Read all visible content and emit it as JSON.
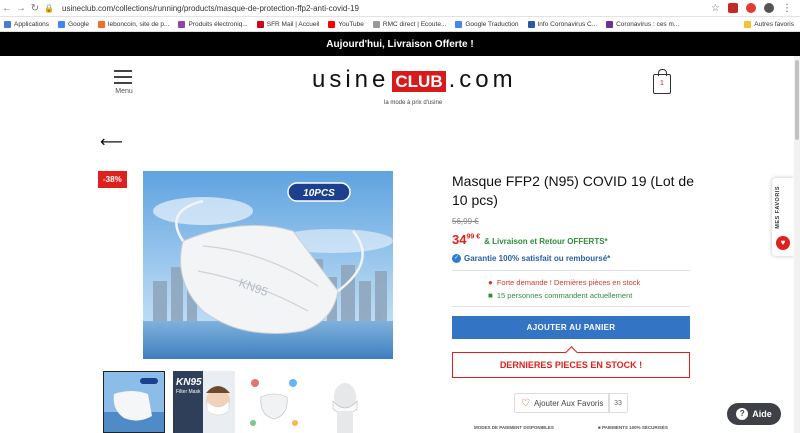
{
  "browser": {
    "url": "usineclub.com/collections/running/products/masque-de-protection-ffp2-anti-covid-19",
    "bookmarks": [
      {
        "label": "Applications",
        "color": "#4a7bd0"
      },
      {
        "label": "Google",
        "color": "#4285f4"
      },
      {
        "label": "leboncoin, site de p...",
        "color": "#f56b2a"
      },
      {
        "label": "Produits électroniq...",
        "color": "#8e44ad"
      },
      {
        "label": "SFR Mail | Accueil",
        "color": "#d0021b"
      },
      {
        "label": "YouTube",
        "color": "#ff0000"
      },
      {
        "label": "RMC direct | Ecoute...",
        "color": "#999999"
      },
      {
        "label": "Google Traduction",
        "color": "#4285f4"
      },
      {
        "label": "Info Coronavirus C...",
        "color": "#2c5aa0"
      },
      {
        "label": "Coronavirus : ces m...",
        "color": "#6b2fa0"
      }
    ],
    "other_bookmarks": "Autres favoris",
    "extension_badge": "1"
  },
  "promo": "Aujourd'hui, Livraison Offerte !",
  "header": {
    "menu_label": "Menu",
    "logo_left": "usine",
    "logo_club": "CLUB",
    "logo_right": ".com",
    "tagline": "la mode à prix d'usine",
    "cart_count": "1"
  },
  "product": {
    "discount": "-38%",
    "photo_badge": "10PCS",
    "photo_mask_text": "KN95",
    "title": "Masque FFP2 (N95) COVID 19 (Lot de 10 pcs)",
    "old_price": "56,99 €",
    "price_main": "34",
    "price_cents": "99 €",
    "shipping": "& Livraison et Retour OFFERTS*",
    "guarantee": "Garantie 100% satisfait ou remboursé*",
    "alert_demand": "Forte demande ! Dernières pièces en stock",
    "alert_people": "15 personnes commandent actuellement",
    "add_to_cart": "AJOUTER AU PANIER",
    "last_stock": "DERNIERES PIECES EN STOCK !",
    "favorite_label": "Ajouter Aux Favoris",
    "favorite_count": "33",
    "payment_label": "MODES DE PAIEMENT DISPONIBLES",
    "secure_label": "PAIEMENTS 100% SÉCURISÉS",
    "thumb2_title": "KN95",
    "thumb2_sub": "Filter Mask"
  },
  "sidebar": {
    "favorites_tab": "MES FAVORIS"
  },
  "help": {
    "label": "Aide"
  },
  "colors": {
    "accent_red": "#e0201c",
    "cart_blue": "#3474c5",
    "green": "#2f8d3a"
  }
}
